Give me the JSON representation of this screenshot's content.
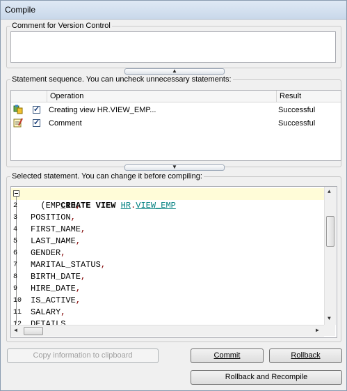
{
  "window": {
    "title": "Compile"
  },
  "comment_group": {
    "label": "Comment for Version Control",
    "value": ""
  },
  "sequence_group": {
    "label": "Statement sequence. You can uncheck unnecessary statements:",
    "columns": {
      "operation": "Operation",
      "result": "Result"
    },
    "rows": [
      {
        "icon": "create-view-icon",
        "checked": true,
        "operation": "Creating view HR.VIEW_EMP...",
        "result": "Successful"
      },
      {
        "icon": "comment-icon",
        "checked": true,
        "operation": "Comment",
        "result": "Successful"
      }
    ]
  },
  "statement_group": {
    "label": "Selected statement. You can change it before compiling:",
    "lines": [
      {
        "num": "",
        "kw": "CREATE VIEW ",
        "schema": "HR",
        "dot": ".",
        "name": "VIEW_EMP",
        "rest": ""
      },
      {
        "num": "2",
        "text": "  (EMP_ID,"
      },
      {
        "num": "3",
        "text": "POSITION,"
      },
      {
        "num": "4",
        "text": "FIRST_NAME,"
      },
      {
        "num": "5",
        "text": "LAST_NAME,"
      },
      {
        "num": "6",
        "text": "GENDER,"
      },
      {
        "num": "7",
        "text": "MARITAL_STATUS,"
      },
      {
        "num": "8",
        "text": "BIRTH_DATE,"
      },
      {
        "num": "9",
        "text": "HIRE_DATE,"
      },
      {
        "num": "10",
        "text": "IS_ACTIVE,"
      },
      {
        "num": "11",
        "text": "SALARY,"
      },
      {
        "num": "12",
        "text": "DETAILS"
      }
    ]
  },
  "buttons": {
    "copy": "Copy information to clipboard",
    "commit": "Commit",
    "rollback": "Rollback",
    "rollback_recompile": "Rollback and Recompile"
  }
}
